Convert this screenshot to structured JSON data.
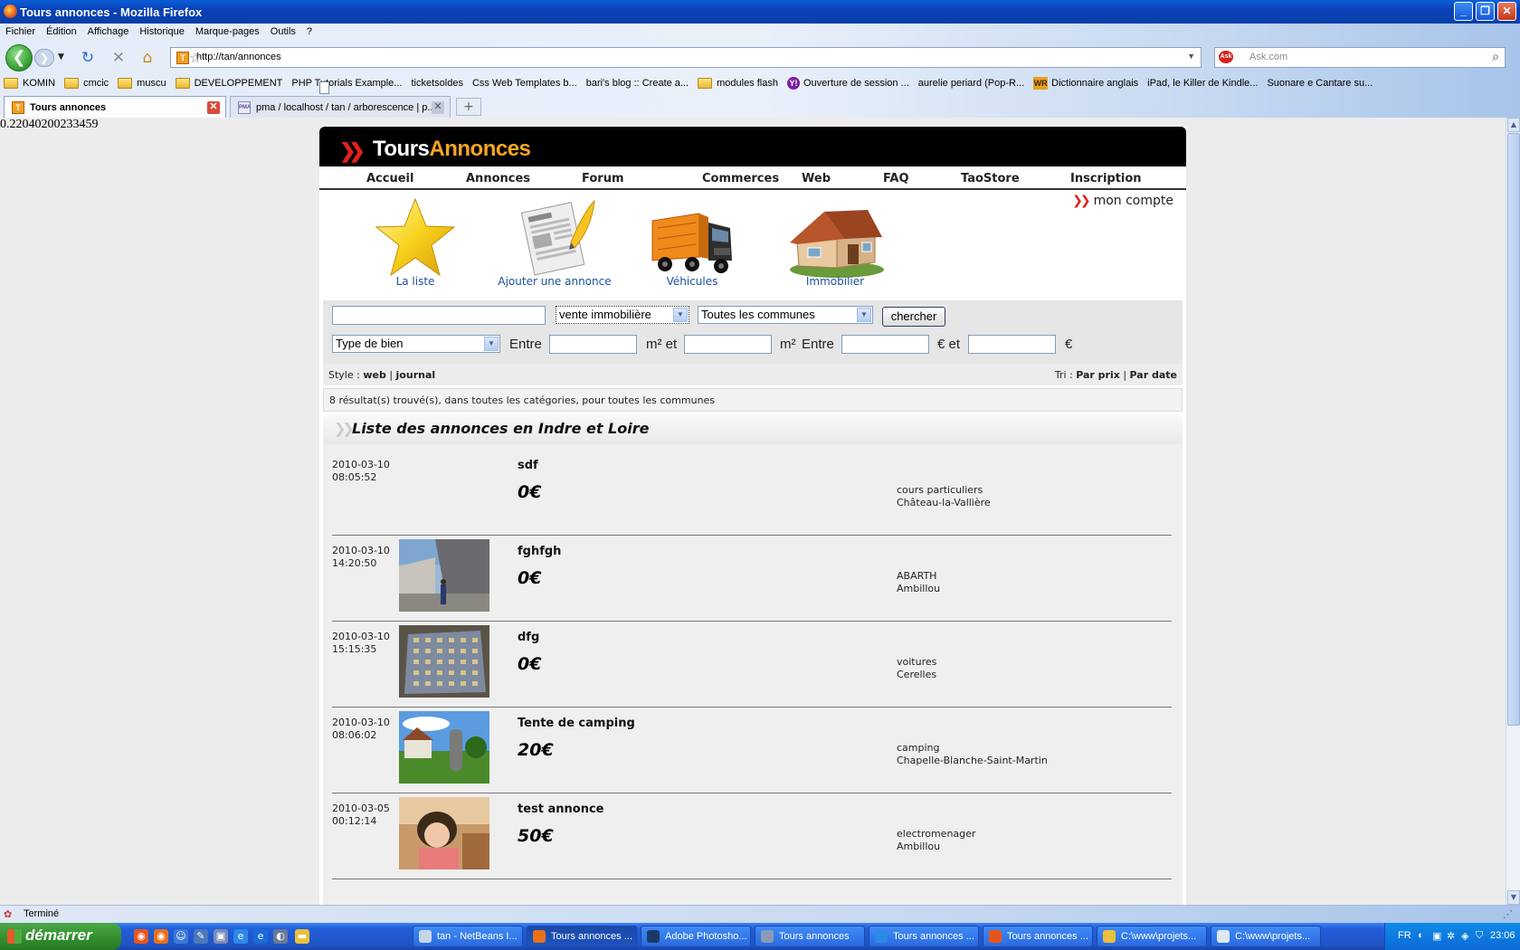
{
  "window": {
    "title": "Tours annonces - Mozilla Firefox"
  },
  "menu": [
    "Fichier",
    "Édition",
    "Affichage",
    "Historique",
    "Marque-pages",
    "Outils",
    "?"
  ],
  "url": "http://tan/annonces",
  "search_placeholder": "Ask.com",
  "bookmarks": [
    {
      "label": "KOMIN",
      "type": "folder"
    },
    {
      "label": "cmcic",
      "type": "folder"
    },
    {
      "label": "muscu",
      "type": "folder"
    },
    {
      "label": "DEVELOPPEMENT",
      "type": "folder"
    },
    {
      "label": "PHP Tutorials Example...",
      "type": "page"
    },
    {
      "label": "ticketsoldes",
      "type": "page"
    },
    {
      "label": "Css Web Templates b...",
      "type": "page"
    },
    {
      "label": "bari's blog :: Create a...",
      "type": "page"
    },
    {
      "label": "modules flash",
      "type": "folder"
    },
    {
      "label": "Ouverture de session ...",
      "type": "yahoo"
    },
    {
      "label": "aurelie periard (Pop-R...",
      "type": "page"
    },
    {
      "label": "Dictionnaire anglais",
      "type": "wr"
    },
    {
      "label": "iPad, le Killer de Kindle...",
      "type": "page"
    },
    {
      "label": "Suonare e Cantare su...",
      "type": "page"
    }
  ],
  "tabs": [
    {
      "label": "Tours annonces",
      "icon": "T"
    },
    {
      "label": "pma / localhost / tan / arborescence | p...",
      "icon": "PMA"
    }
  ],
  "debug_value": "0.22040200233459",
  "site": {
    "logo_part1": "Tours",
    "logo_part2": "Annonces",
    "nav": [
      "Accueil",
      "Annonces",
      "Forum",
      "Commerces",
      "Web",
      "FAQ",
      "TaoStore",
      "Inscription"
    ],
    "account_link": "mon compte",
    "categories": [
      "La liste",
      "Ajouter une annonce",
      "Véhicules",
      "Immobilier"
    ]
  },
  "filters": {
    "keyword": "",
    "type_select": "vente immobilière",
    "commune_select": "Toutes les communes",
    "search_button": "chercher",
    "bien_select": "Type de bien",
    "entre1": "Entre",
    "m2et": "m² et",
    "m2": "m²",
    "entre2": "Entre",
    "euro_et": "€ et",
    "euro": "€"
  },
  "stylebar": {
    "style_label": "Style : ",
    "web": "web",
    "sep": " | ",
    "journal": "journal",
    "tri_label": "Tri : ",
    "par_prix": "Par prix",
    "par_date": "Par date"
  },
  "results_text": "8 résultat(s) trouvé(s), dans toutes les catégories, pour toutes les communes",
  "list_title": "Liste des annonces en Indre et Loire",
  "ads": [
    {
      "date": "2010-03-10",
      "time": "08:05:52",
      "title": "sdf",
      "price": "0€",
      "category": "cours particuliers",
      "commune": "Château-la-Vallière",
      "thumb": "none"
    },
    {
      "date": "2010-03-10",
      "time": "14:20:50",
      "title": "fghfgh",
      "price": "0€",
      "category": "ABARTH",
      "commune": "Ambillou",
      "thumb": "street"
    },
    {
      "date": "2010-03-10",
      "time": "15:15:35",
      "title": "dfg",
      "price": "0€",
      "category": "voitures",
      "commune": "Cerelles",
      "thumb": "fabric"
    },
    {
      "date": "2010-03-10",
      "time": "08:06:02",
      "title": "Tente de camping",
      "price": "20€",
      "category": "camping",
      "commune": "Chapelle-Blanche-Saint-Martin",
      "thumb": "garden"
    },
    {
      "date": "2010-03-05",
      "time": "00:12:14",
      "title": "test annonce",
      "price": "50€",
      "category": "electromenager",
      "commune": "Ambillou",
      "thumb": "child"
    }
  ],
  "status": "Terminé",
  "taskbar": {
    "start": "démarrer",
    "buttons": [
      {
        "label": "tan - NetBeans I...",
        "icon": "nb"
      },
      {
        "label": "Tours annonces ...",
        "icon": "ff",
        "active": true
      },
      {
        "label": "Adobe Photosho...",
        "icon": "ps"
      },
      {
        "label": "Tours annonces",
        "icon": "cr"
      },
      {
        "label": "Tours annonces ...",
        "icon": "ie"
      },
      {
        "label": "Tours annonces ...",
        "icon": "ch"
      },
      {
        "label": "C:\\www\\projets...",
        "icon": "fo"
      },
      {
        "label": "C:\\www\\projets...",
        "icon": "np"
      }
    ],
    "lang": "FR",
    "clock": "23:06"
  }
}
